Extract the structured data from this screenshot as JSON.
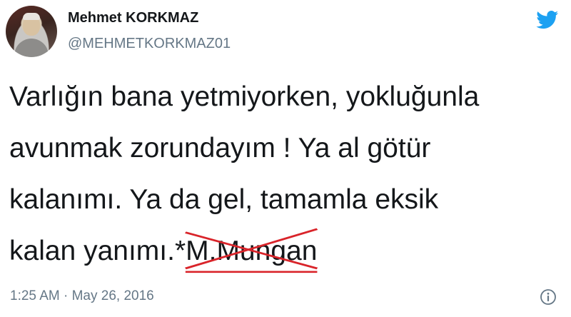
{
  "author": {
    "name": "Mehmet KORKMAZ",
    "handle": "@MEHMETKORKMAZ01"
  },
  "tweet": {
    "lines": [
      "Varlığın bana yetmiyorken, yokluğunla",
      "avunmak zorundayım ! Ya al götür",
      "kalanımı. Ya da gel, tamamla eksik"
    ],
    "last_line_prefix": "kalan yanımı.*",
    "crossed_out_attribution": "M.Mungan",
    "timestamp": "1:25 AM · May 26, 2016"
  },
  "icons": {
    "logo": "twitter-bird-icon",
    "info": "info-icon"
  },
  "colors": {
    "brand": "#1da1f2",
    "text": "#14171a",
    "muted": "#657786",
    "strike": "#d9242a"
  }
}
